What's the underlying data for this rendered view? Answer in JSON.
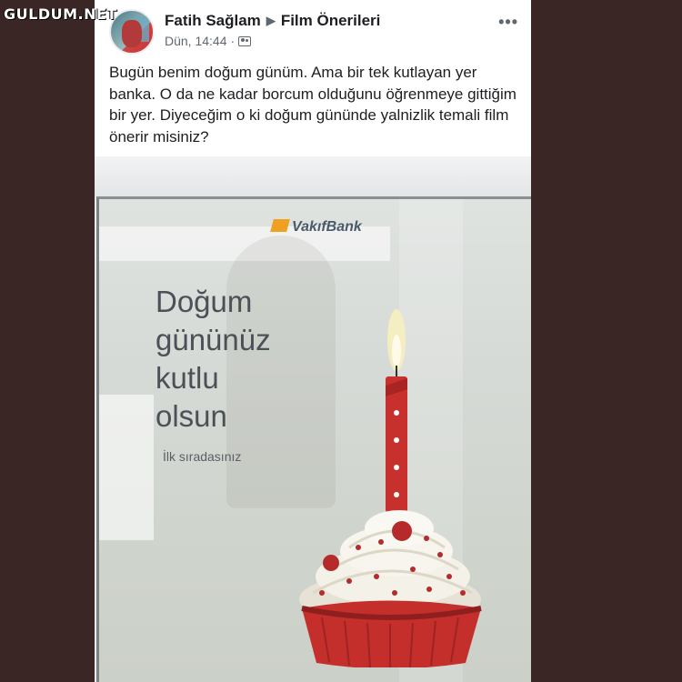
{
  "watermark": "GULDUM.NET",
  "post": {
    "author": "Fatih Sağlam",
    "group": "Film Önerileri",
    "time": "Dün, 14:44",
    "audience_icon": "group-icon",
    "more_icon": "more-horizontal-icon",
    "text": "Bugün benim doğum günüm. Ama bir tek kutlayan yer banka. O da ne kadar borcum olduğunu öğrenmeye gittiğim bir yer. Diyeceğim o ki doğum gününde yalnizlik temali film önerir misiniz?"
  },
  "photo": {
    "brand": "VakıfBank",
    "greeting_lines": [
      "Doğum",
      "gününüz",
      "kutlu",
      "olsun"
    ],
    "subtext": "İlk sıradasınız"
  },
  "colors": {
    "page_bg": "#3a2624",
    "card_bg": "#ffffff",
    "text_primary": "#1c1e21",
    "text_secondary": "#616770",
    "candle_red": "#c8302e",
    "frosting": "#f3f1e8"
  }
}
